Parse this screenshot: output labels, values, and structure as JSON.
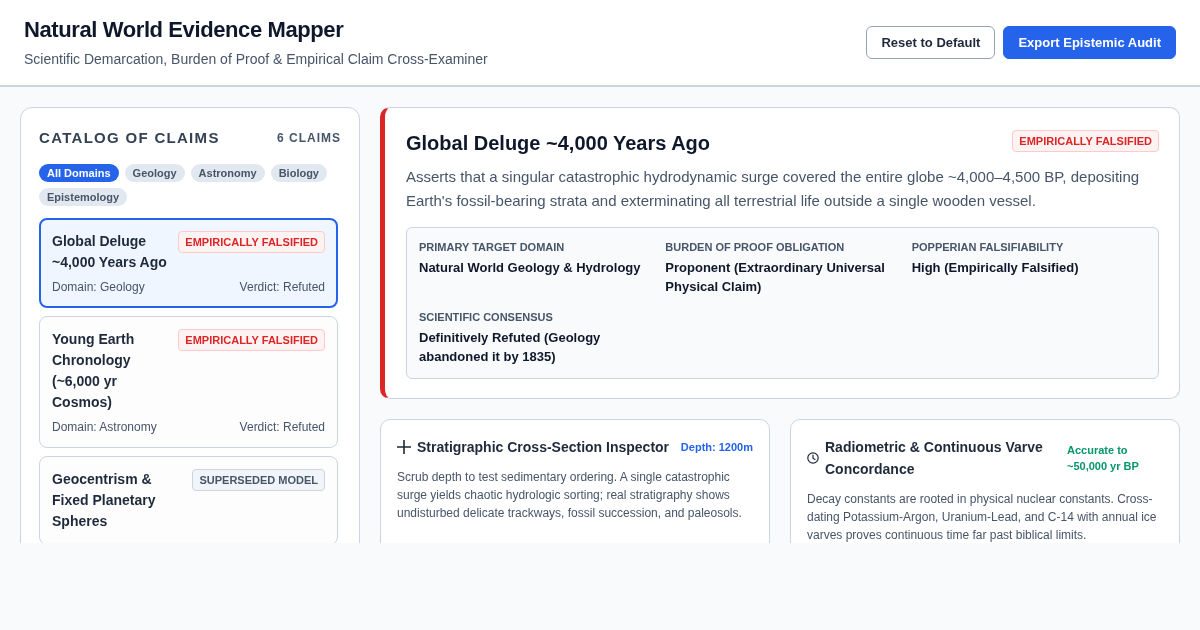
{
  "header": {
    "title": "Natural World Evidence Mapper",
    "subtitle": "Scientific Demarcation, Burden of Proof & Empirical Claim Cross-Examiner",
    "buttons": [
      {
        "label": "Reset to Default",
        "kind": "outline"
      },
      {
        "label": "Export Epistemic Audit",
        "kind": "primary"
      }
    ]
  },
  "catalog": {
    "title": "CATALOG OF CLAIMS",
    "count": "6 CLAIMS",
    "filters": [
      {
        "label": "All Domains",
        "selected": true
      },
      {
        "label": "Geology",
        "selected": false
      },
      {
        "label": "Astronomy",
        "selected": false
      },
      {
        "label": "Biology",
        "selected": false
      },
      {
        "label": "Epistemology",
        "selected": false
      }
    ],
    "claims": [
      {
        "title": "Global Deluge ~4,000 Years Ago",
        "badge": {
          "text": "EMPIRICALLY FALSIFIED",
          "kind": "falsified"
        },
        "domain": "Domain: Geology",
        "verdict": "Verdict: Refuted",
        "selected": true
      },
      {
        "title": "Young Earth Chronology (~6,000 yr Cosmos)",
        "badge": {
          "text": "EMPIRICALLY FALSIFIED",
          "kind": "falsified"
        },
        "domain": "Domain: Astronomy",
        "verdict": "Verdict: Refuted",
        "selected": false
      },
      {
        "title": "Geocentrism & Fixed Planetary Spheres",
        "badge": {
          "text": "SUPERSEDED MODEL",
          "kind": "superseded"
        },
        "selected": false
      }
    ]
  },
  "detail": {
    "title": "Global Deluge ~4,000 Years Ago",
    "badge": {
      "text": "EMPIRICALLY FALSIFIED",
      "kind": "falsified"
    },
    "description": "Asserts that a singular catastrophic hydrodynamic surge covered the entire globe ~4,000–4,500 BP, depositing Earth's fossil-bearing strata and exterminating all terrestrial life outside a single wooden vessel.",
    "fields": [
      {
        "label": "PRIMARY TARGET DOMAIN",
        "value": "Natural World Geology & Hydrology"
      },
      {
        "label": "BURDEN OF PROOF OBLIGATION",
        "value": "Proponent (Extraordinary Universal Physical Claim)"
      },
      {
        "label": "POPPERIAN FALSIFIABILITY",
        "value": "High (Empirically Falsified)"
      },
      {
        "label": "SCIENTIFIC CONSENSUS",
        "value": "Definitively Refuted (Geology abandoned it by 1835)"
      }
    ]
  },
  "tools": [
    {
      "kind": "section",
      "title": "Stratigraphic Cross-Section Inspector",
      "tag": {
        "text": "Depth: 1200m",
        "color": "#2563eb"
      },
      "description": "Scrub depth to test sedimentary ordering. A single catastrophic surge yields chaotic hydrologic sorting; real stratigraphy shows undisturbed delicate trackways, fossil succession, and paleosols."
    },
    {
      "kind": "dating",
      "title": "Radiometric & Continuous Varve Concordance",
      "tag": {
        "text": "Accurate to ~50,000 yr BP",
        "color": "#059669"
      },
      "description": "Decay constants are rooted in physical nuclear constants. Cross-dating Potassium-Argon, Uranium-Lead, and C-14 with annual ice varves proves continuous time far past biblical limits."
    }
  ]
}
